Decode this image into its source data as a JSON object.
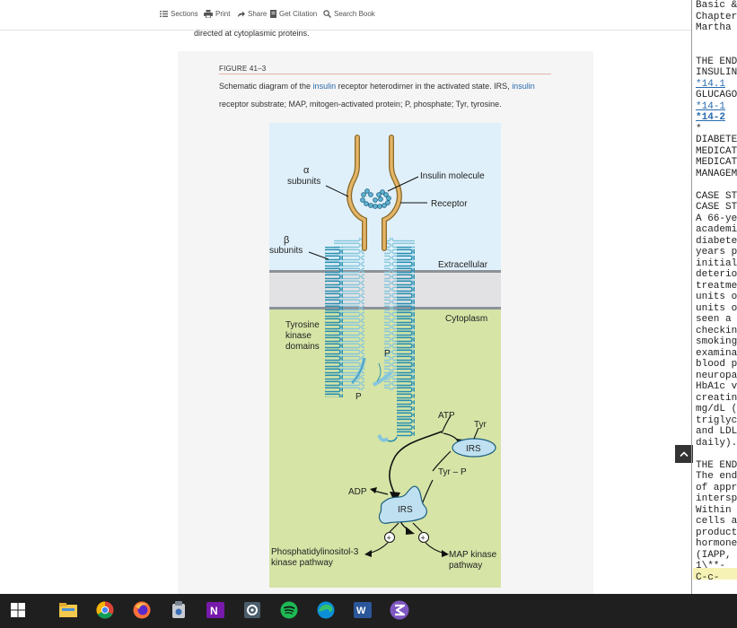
{
  "toolbar": {
    "sections_label": "Sections",
    "print_label": "Print",
    "share_label": "Share",
    "citation_label": "Get Citation",
    "search_label": "Search Book"
  },
  "body_text": {
    "intro": "directed at cytoplasmic proteins."
  },
  "figure": {
    "label": "FIGURE 41–3",
    "caption": {
      "l1_a": "Schematic diagram of the ",
      "l1_link1": "insulin",
      "l1_b": " receptor heterodimer in the activated state. IRS, ",
      "l1_link2": "insulin",
      "l2": "receptor substrate; MAP, mitogen-activated protein; P, phosphate; Tyr, tyrosine."
    },
    "diagram": {
      "alpha": "α",
      "alpha_sub": "subunits",
      "beta": "β",
      "beta_sub": "subunits",
      "insulin_molecule": "Insulin molecule",
      "receptor": "Receptor",
      "extracellular": "Extracellular",
      "cytoplasm": "Cytoplasm",
      "tk1": "Tyrosine",
      "tk2": "kinase",
      "tk3": "domains",
      "p": "P",
      "atp": "ATP",
      "tyr": "Tyr",
      "irs": "IRS",
      "tyr_p": "Tyr – P",
      "adp": "ADP",
      "plus": "+",
      "pi3k1": "Phosphatidylinositol-3",
      "pi3k2": "kinase pathway",
      "mapk1": "MAP kinase",
      "mapk2": "pathway"
    }
  },
  "side_panel": {
    "lines": [
      {
        "text": "Basic &",
        "type": "text"
      },
      {
        "text": "Chapter",
        "type": "text"
      },
      {
        "text": "Martha",
        "type": "text"
      },
      {
        "text": "",
        "type": "text"
      },
      {
        "text": "",
        "type": "text"
      },
      {
        "text": "THE END",
        "type": "text"
      },
      {
        "text": "INSULIN",
        "type": "text"
      },
      {
        "text": "*14.1",
        "type": "link"
      },
      {
        "text": "GLUCAGO",
        "type": "text"
      },
      {
        "text": "*14-1",
        "type": "link"
      },
      {
        "text": "*14-2",
        "type": "link-bold"
      },
      {
        "text": "*",
        "type": "text"
      },
      {
        "text": "DIABETE",
        "type": "text"
      },
      {
        "text": "MEDICAT",
        "type": "text"
      },
      {
        "text": "MEDICAT",
        "type": "text"
      },
      {
        "text": "MANAGEM",
        "type": "text"
      },
      {
        "text": "",
        "type": "text"
      },
      {
        "text": "CASE ST",
        "type": "text"
      },
      {
        "text": "CASE ST",
        "type": "text"
      },
      {
        "text": "A 66-ye",
        "type": "text"
      },
      {
        "text": "academi",
        "type": "text"
      },
      {
        "text": "diabete",
        "type": "text"
      },
      {
        "text": "years p",
        "type": "text"
      },
      {
        "text": "initial",
        "type": "text"
      },
      {
        "text": "deterio",
        "type": "text"
      },
      {
        "text": "treatme",
        "type": "text"
      },
      {
        "text": "units o",
        "type": "text"
      },
      {
        "text": "units o",
        "type": "text"
      },
      {
        "text": "seen a",
        "type": "text"
      },
      {
        "text": "checkin",
        "type": "text"
      },
      {
        "text": "smoking",
        "type": "text"
      },
      {
        "text": "examina",
        "type": "text"
      },
      {
        "text": "blood p",
        "type": "text"
      },
      {
        "text": "neuropa",
        "type": "text"
      },
      {
        "text": "HbA1c v",
        "type": "text"
      },
      {
        "text": "creatin",
        "type": "text"
      },
      {
        "text": "mg/dL (",
        "type": "text"
      },
      {
        "text": "triglyc",
        "type": "text"
      },
      {
        "text": "and LDL",
        "type": "text"
      },
      {
        "text": "daily).",
        "type": "text"
      },
      {
        "text": "",
        "type": "text"
      },
      {
        "text": "THE END",
        "type": "text"
      },
      {
        "text": "The end",
        "type": "text"
      },
      {
        "text": "of appr",
        "type": "text"
      },
      {
        "text": "intersp",
        "type": "text"
      },
      {
        "text": "Within",
        "type": "text"
      },
      {
        "text": "cells a",
        "type": "text"
      },
      {
        "text": "product",
        "type": "text"
      },
      {
        "text": "hormone",
        "type": "text"
      },
      {
        "text": "(IAPP,",
        "type": "text"
      },
      {
        "text": "1\\**-",
        "type": "text"
      },
      {
        "text": "C-c-",
        "type": "text"
      }
    ]
  },
  "taskbar": {
    "apps": [
      "windows-start",
      "file-explorer",
      "chrome",
      "firefox",
      "app-tool",
      "onenote",
      "settings",
      "spotify",
      "edge",
      "word",
      "emacs"
    ]
  }
}
